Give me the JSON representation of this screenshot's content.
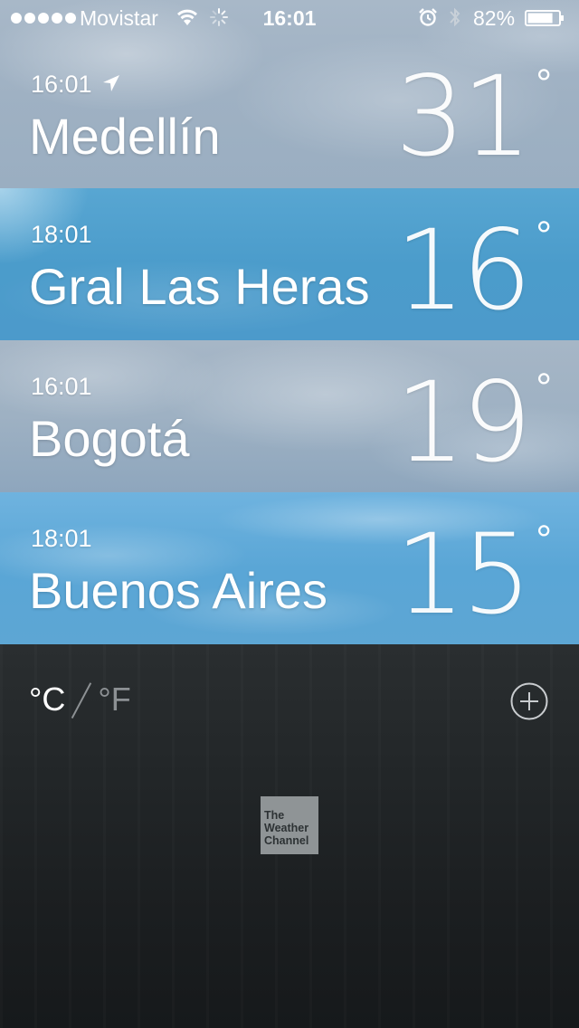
{
  "status_bar": {
    "carrier": "Movistar",
    "time": "16:01",
    "battery_percent": "82%",
    "battery_level": 0.82
  },
  "cities": [
    {
      "local_time": "16:01",
      "name": "Medellín",
      "temperature": "31",
      "current_location": true
    },
    {
      "local_time": "18:01",
      "name": "Gral Las Heras",
      "temperature": "16"
    },
    {
      "local_time": "16:01",
      "name": "Bogotá",
      "temperature": "19"
    },
    {
      "local_time": "18:01",
      "name": "Buenos Aires",
      "temperature": "15"
    }
  ],
  "degree_symbol": "°",
  "units": {
    "celsius": "°C",
    "fahrenheit": "°F",
    "selected": "celsius"
  },
  "add_button_icon": "plus-circle-icon",
  "attribution": {
    "line1": "The",
    "line2": "Weather",
    "line3": "Channel"
  }
}
